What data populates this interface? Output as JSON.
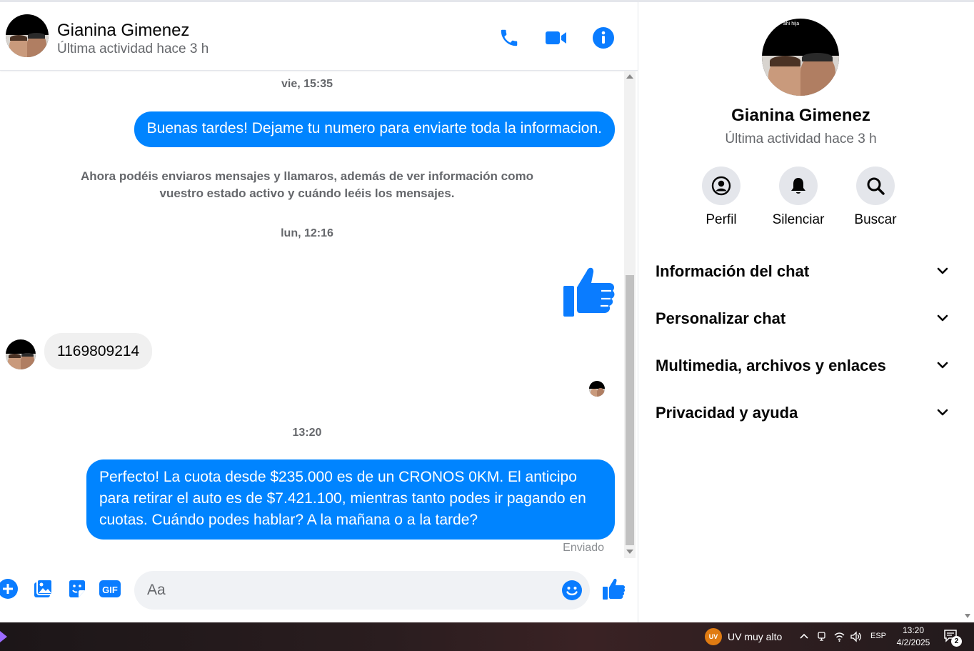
{
  "contact": {
    "name": "Gianina Gimenez",
    "status": "Última actividad hace 3 h",
    "avatar_caption": "ahi hija"
  },
  "header_actions": [
    "phone-icon",
    "video-camera-icon",
    "info-icon"
  ],
  "messages": {
    "ts1": "vie, 15:35",
    "out1": "Buenas tardes! Dejame tu numero para enviarte toda la informacion.",
    "system": "Ahora podéis enviaros mensajes y llamaros, además de ver información como vuestro estado activo y cuándo leéis los mensajes.",
    "ts2": "lun, 12:16",
    "in1": "1169809214",
    "ts3": "13:20",
    "out2": "Perfecto! La cuota desde $235.000 es de un CRONOS 0KM. El anticipo para retirar el auto es de $7.421.100, mientras tanto podes ir pagando en cuotas. Cuándo podes hablar? A la mañana o a la tarde?",
    "sent_status": "Enviado"
  },
  "composer": {
    "placeholder": "Aa",
    "value": ""
  },
  "panel": {
    "actions": {
      "profile": "Perfil",
      "mute": "Silenciar",
      "search": "Buscar"
    },
    "sections": {
      "chat_info": "Información del chat",
      "customize": "Personalizar chat",
      "media": "Multimedia, archivos y enlaces",
      "privacy": "Privacidad y ayuda"
    }
  },
  "taskbar": {
    "weather_badge": "UV",
    "weather": "UV muy alto",
    "language": "ESP",
    "time": "13:20",
    "date": "4/2/2025",
    "notifications": "2"
  },
  "colors": {
    "accent": "#0084ff",
    "icon_blue": "#0a7cff",
    "bubble_in": "#f0f0f0",
    "muted_text": "#65676b"
  }
}
